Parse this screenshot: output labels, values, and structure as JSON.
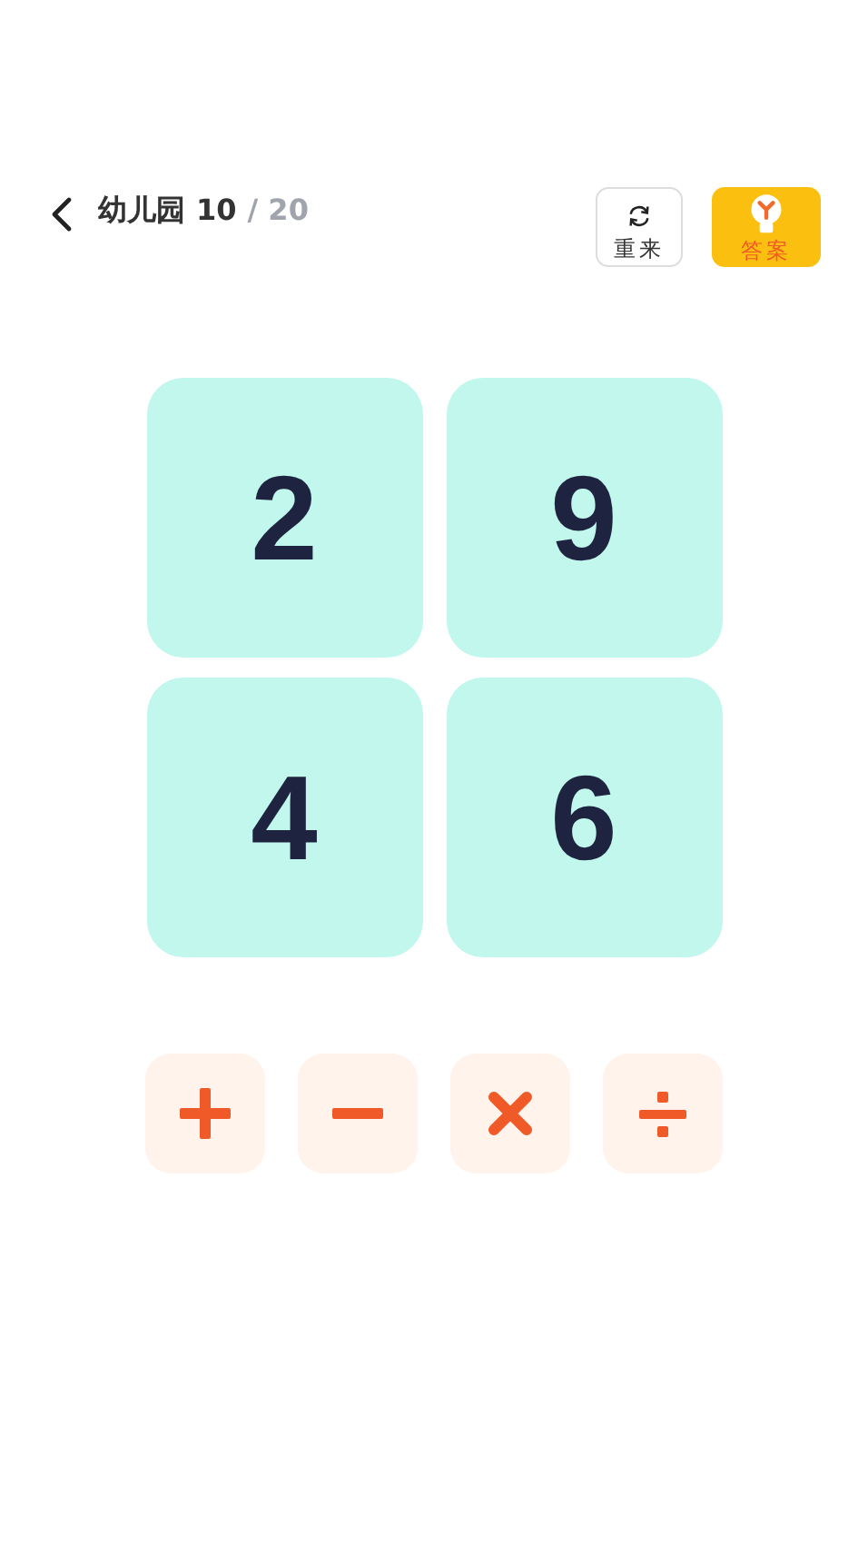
{
  "header": {
    "level_name": "幼儿园",
    "current": "10",
    "total": "/ 20"
  },
  "actions": [
    {
      "kind": "restart",
      "label": "重来"
    },
    {
      "kind": "answer",
      "label": "答案"
    }
  ],
  "cards": [
    "2",
    "9",
    "4",
    "6"
  ],
  "operators": [
    {
      "kind": "plus"
    },
    {
      "kind": "minus"
    },
    {
      "kind": "times"
    },
    {
      "kind": "divide"
    }
  ]
}
